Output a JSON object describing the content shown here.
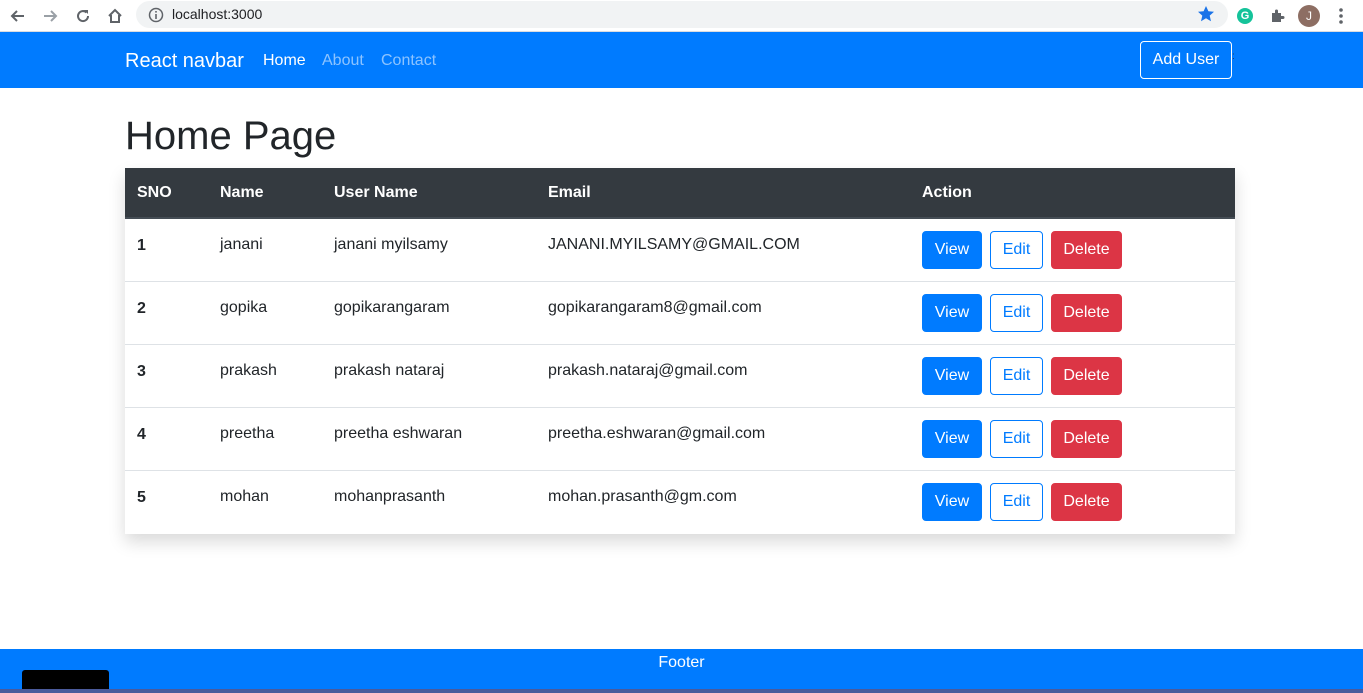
{
  "browser": {
    "url": "localhost:3000",
    "profile_initial": "J",
    "extension_initial": "G"
  },
  "navbar": {
    "brand": "React navbar",
    "links": [
      "Home",
      "About",
      "Contact"
    ],
    "add_user_label": "Add User"
  },
  "main": {
    "title": "Home Page",
    "table": {
      "headers": [
        "SNO",
        "Name",
        "User Name",
        "Email",
        "Action"
      ],
      "rows": [
        {
          "sno": "1",
          "name": "janani",
          "username": "janani myilsamy",
          "email": "JANANI.MYILSAMY@GMAIL.COM"
        },
        {
          "sno": "2",
          "name": "gopika",
          "username": "gopikarangaram",
          "email": "gopikarangaram8@gmail.com"
        },
        {
          "sno": "3",
          "name": "prakash",
          "username": "prakash nataraj",
          "email": "prakash.nataraj@gmail.com"
        },
        {
          "sno": "4",
          "name": "preetha",
          "username": "preetha eshwaran",
          "email": "preetha.eshwaran@gmail.com"
        },
        {
          "sno": "5",
          "name": "mohan",
          "username": "mohanprasanth",
          "email": "mohan.prasanth@gm.com"
        }
      ],
      "actions": {
        "view": "View",
        "edit": "Edit",
        "delete": "Delete"
      }
    }
  },
  "footer": {
    "text": "Footer"
  },
  "colors": {
    "primary": "#007bff",
    "danger": "#dc3545",
    "table_header": "#343a40"
  }
}
